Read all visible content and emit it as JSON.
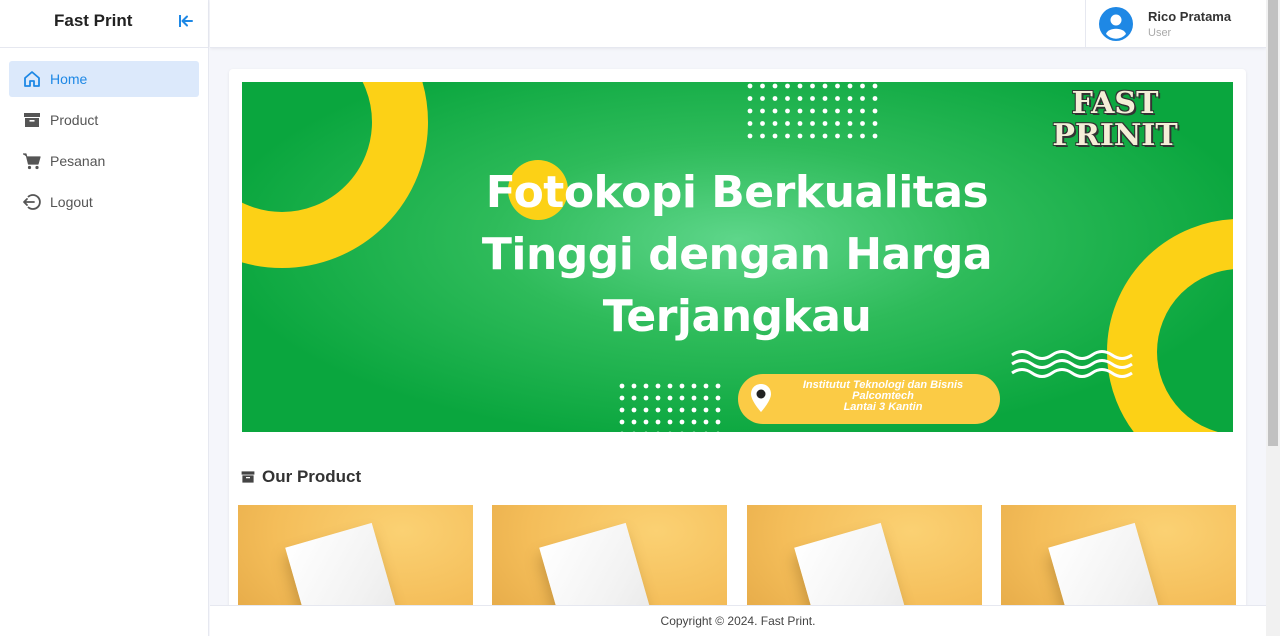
{
  "app": {
    "brand": "Fast Print"
  },
  "sidebar": {
    "items": [
      {
        "label": "Home",
        "icon": "home-icon",
        "active": true
      },
      {
        "label": "Product",
        "icon": "archive-box-icon",
        "active": false
      },
      {
        "label": "Pesanan",
        "icon": "cart-icon",
        "active": false
      },
      {
        "label": "Logout",
        "icon": "logout-icon",
        "active": false
      }
    ]
  },
  "user": {
    "name": "Rico Pratama",
    "role": "User"
  },
  "banner": {
    "heading_lines": [
      "Fotokopi Berkualitas",
      "Tinggi dengan Harga",
      "Terjangkau"
    ],
    "logo_lines": [
      "FAST",
      "PRINIT"
    ],
    "location_lines": [
      "Institutut Teknologi dan Bisnis",
      "Palcomtech",
      "Lantai 3 Kantin"
    ]
  },
  "products_section": {
    "title": "Our Product",
    "card_count": 4
  },
  "footer": {
    "copyright": "Copyright © 2024. Fast Print."
  },
  "colors": {
    "accent": "#1e88e5",
    "banner_green": "#0aa63e",
    "banner_yellow": "#fbcb45",
    "active_bg": "#dce9fb"
  }
}
